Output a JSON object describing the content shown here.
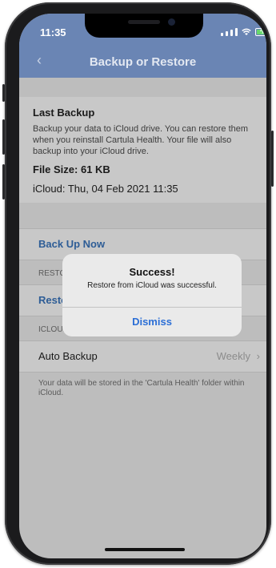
{
  "status_bar": {
    "time": "11:35"
  },
  "header": {
    "title": "Backup or Restore"
  },
  "last_backup": {
    "title": "Last Backup",
    "description": "Backup your data to iCloud drive. You can restore them when you reinstall Cartula Health. Your file will also backup into your iCloud drive.",
    "file_size": "File Size: 61 KB",
    "icloud_date": "iCloud: Thu, 04 Feb 2021 11:35"
  },
  "actions": {
    "backup_now": "Back Up Now",
    "restore_header": "RESTORE",
    "restore_label": "Restore"
  },
  "icloud_setting": {
    "header": "ICLOUD SETTING",
    "auto_backup_label": "Auto Backup",
    "auto_backup_value": "Weekly",
    "note": "Your data will be stored in the 'Cartula Health' folder within iCloud."
  },
  "alert": {
    "title": "Success!",
    "message": "Restore from iCloud was successful.",
    "button": "Dismiss"
  },
  "colors": {
    "header": "#6a85b4",
    "link": "#2e5d96",
    "alert_button": "#2c6fd6"
  }
}
